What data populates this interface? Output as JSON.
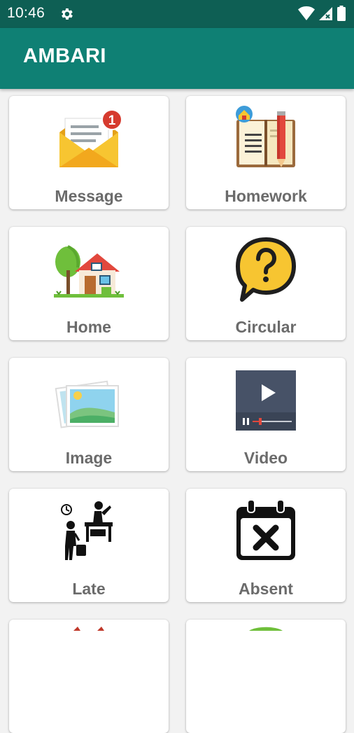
{
  "status_bar": {
    "time": "10:46"
  },
  "app_bar": {
    "title": "AMBARI"
  },
  "menu": {
    "items": [
      {
        "label": "Message",
        "icon": "envelope-notification-icon",
        "badge": "1"
      },
      {
        "label": "Homework",
        "icon": "book-pencil-icon"
      },
      {
        "label": "Home",
        "icon": "house-icon"
      },
      {
        "label": "Circular",
        "icon": "question-bubble-icon"
      },
      {
        "label": "Image",
        "icon": "photo-icon"
      },
      {
        "label": "Video",
        "icon": "video-player-icon"
      },
      {
        "label": "Late",
        "icon": "late-arrival-icon"
      },
      {
        "label": "Absent",
        "icon": "calendar-x-icon"
      }
    ]
  },
  "colors": {
    "app_bar": "#0f8074",
    "status_bar": "#0e5f54",
    "label": "#6b6b6b"
  }
}
